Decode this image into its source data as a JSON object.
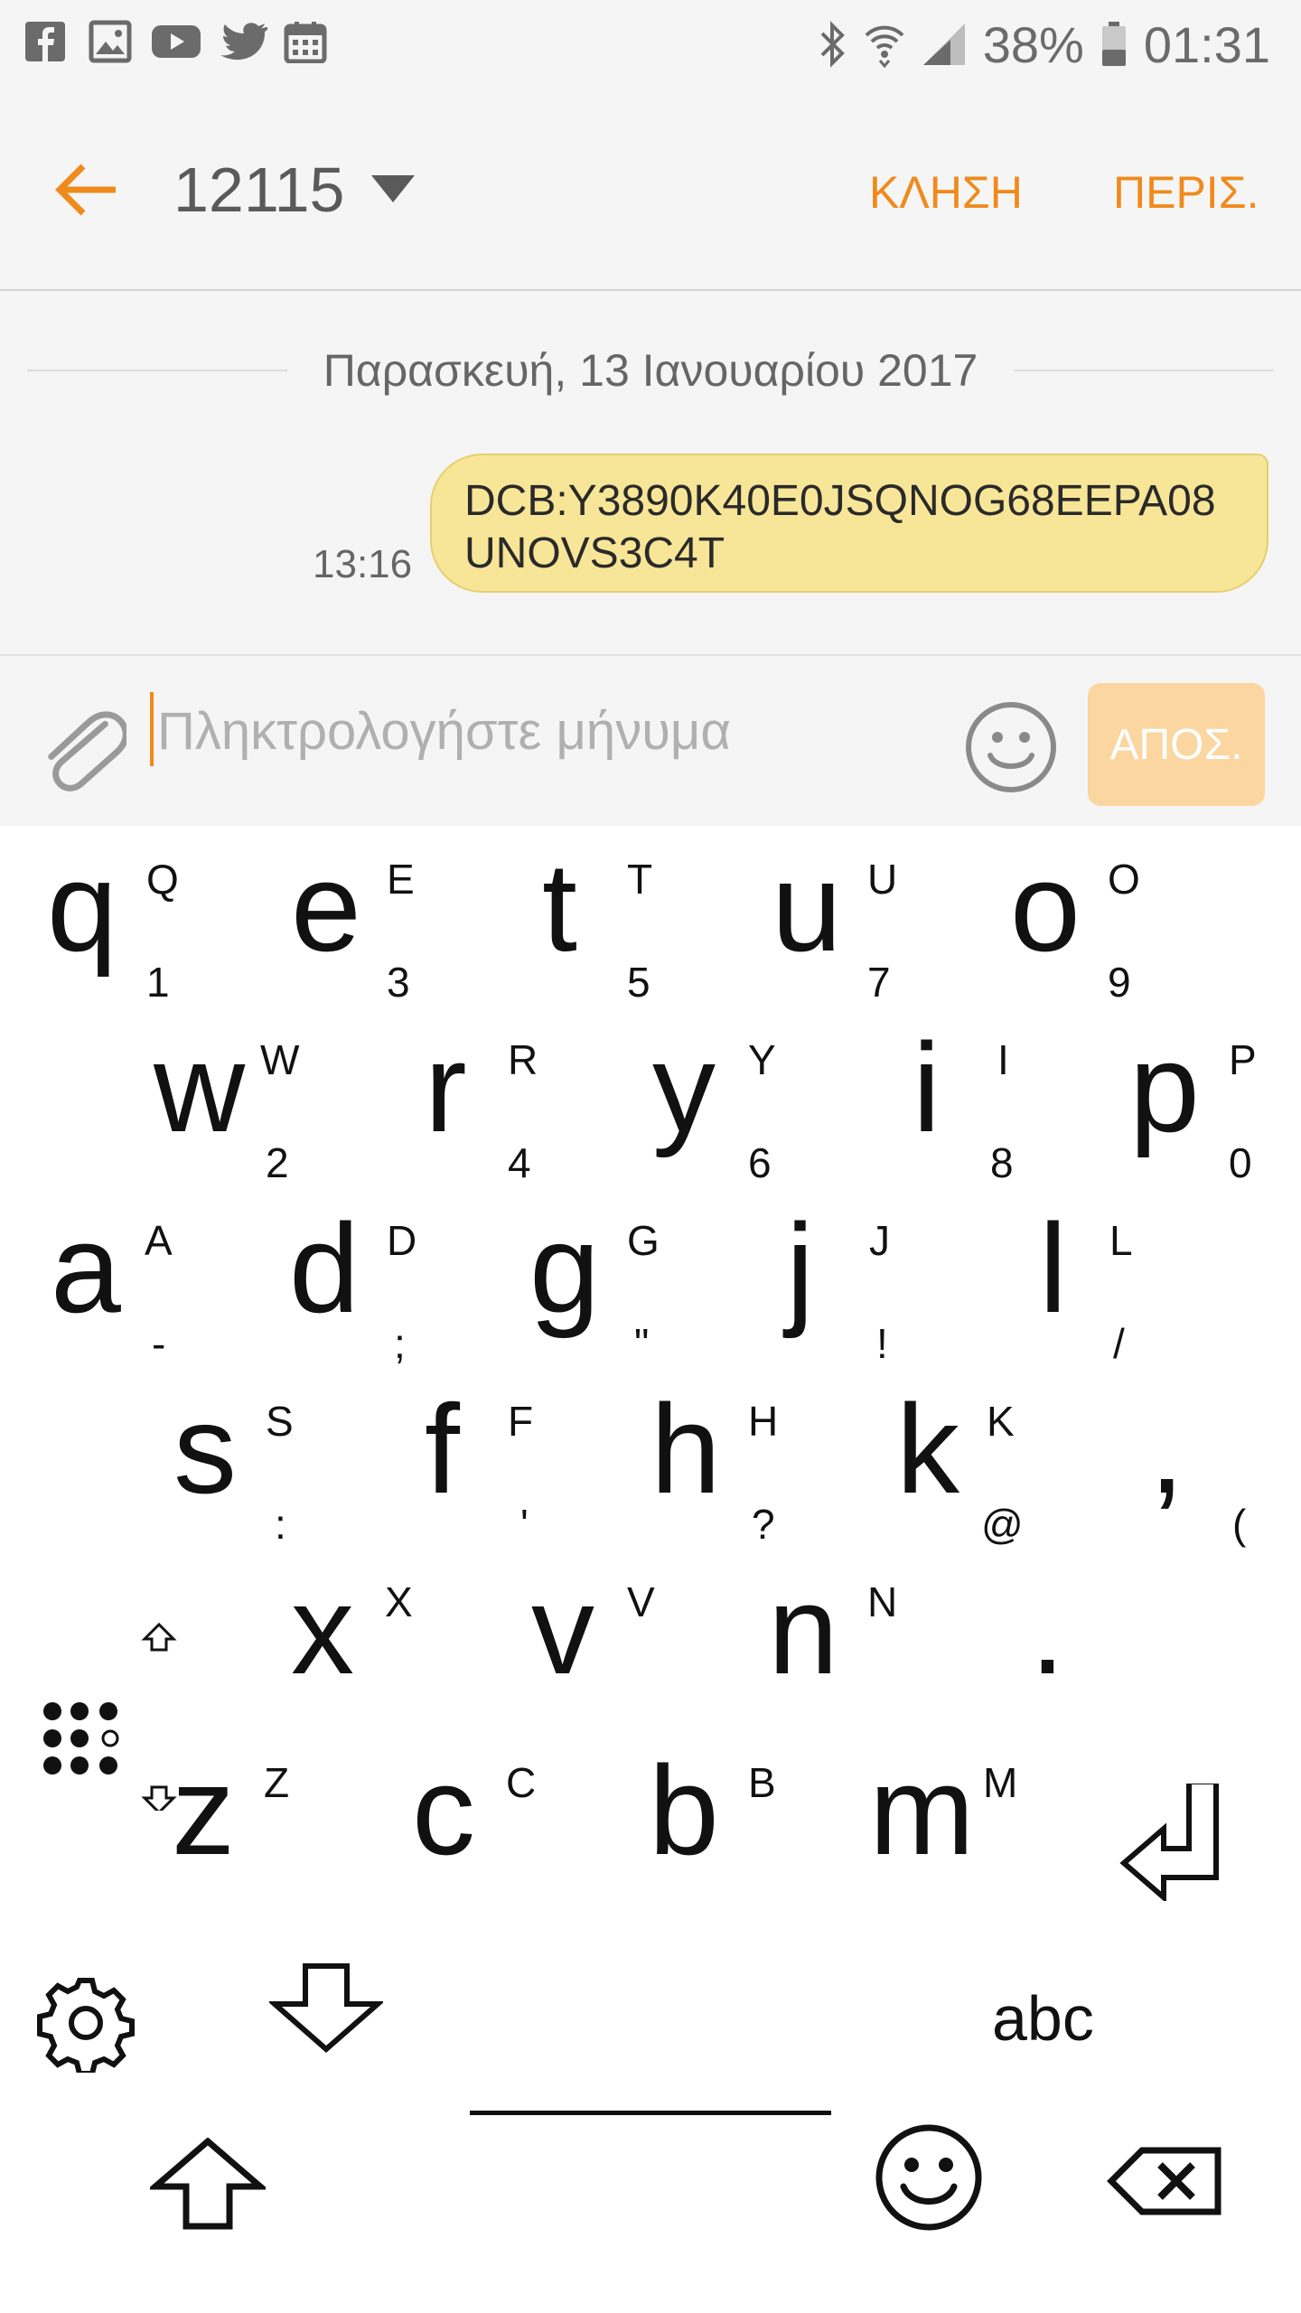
{
  "status_bar": {
    "icons_left": [
      "facebook-icon",
      "gallery-icon",
      "youtube-icon",
      "twitter-icon",
      "calendar-icon"
    ],
    "icons_right": [
      "bluetooth-icon",
      "wifi-icon",
      "signal-icon",
      "battery-icon"
    ],
    "battery": "38%",
    "time": "01:31"
  },
  "header": {
    "contact": "12115",
    "call_label": "ΚΛΗΣΗ",
    "more_label": "ΠΕΡΙΣ.",
    "accent": "#ef8a1c"
  },
  "conversation": {
    "date": "Παρασκευή, 13 Ιανουαρίου 2017",
    "messages": [
      {
        "time": "13:16",
        "line1": "DCB:Y3890K40E0JSQNOG68EEPA08",
        "line2": "UNOVS3C4T",
        "bubble_color": "#f8e698"
      }
    ]
  },
  "composer": {
    "placeholder": "Πληκτρολογήστε μήνυμα",
    "send_label": "ΑΠΟΣ."
  },
  "keyboard": {
    "rows": [
      [
        {
          "k": "q",
          "sup": "Q",
          "sub": "1"
        },
        {
          "k": "e",
          "sup": "E",
          "sub": "3"
        },
        {
          "k": "t",
          "sup": "T",
          "sub": "5"
        },
        {
          "k": "u",
          "sup": "U",
          "sub": "7"
        },
        {
          "k": "o",
          "sup": "O",
          "sub": "9"
        }
      ],
      [
        {
          "k": "w",
          "sup": "W",
          "sub": "2"
        },
        {
          "k": "r",
          "sup": "R",
          "sub": "4"
        },
        {
          "k": "y",
          "sup": "Y",
          "sub": "6"
        },
        {
          "k": "i",
          "sup": "I",
          "sub": "8"
        },
        {
          "k": "p",
          "sup": "P",
          "sub": "0"
        }
      ],
      [
        {
          "k": "a",
          "sup": "A",
          "sub": "-"
        },
        {
          "k": "d",
          "sup": "D",
          "sub": ";"
        },
        {
          "k": "g",
          "sup": "G",
          "sub": "\""
        },
        {
          "k": "j",
          "sup": "J",
          "sub": "!"
        },
        {
          "k": "l",
          "sup": "L",
          "sub": "/"
        }
      ],
      [
        {
          "k": "s",
          "sup": "S",
          "sub": ":"
        },
        {
          "k": "f",
          "sup": "F",
          "sub": "'"
        },
        {
          "k": "h",
          "sup": "H",
          "sub": "?"
        },
        {
          "k": "k",
          "sup": "K",
          "sub": "@"
        },
        {
          "k": ",",
          "sup": "",
          "sub": "("
        }
      ],
      [
        {
          "k": "x",
          "sup": "X",
          "sub": ""
        },
        {
          "k": "v",
          "sup": "V",
          "sub": ""
        },
        {
          "k": "n",
          "sup": "N",
          "sub": ""
        },
        {
          "k": ".",
          "sup": "",
          "sub": ""
        }
      ],
      [
        {
          "k": "z",
          "sup": "Z",
          "sub": ""
        },
        {
          "k": "c",
          "sup": "C",
          "sub": ""
        },
        {
          "k": "b",
          "sup": "B",
          "sub": ""
        },
        {
          "k": "m",
          "sup": "M",
          "sub": ""
        }
      ]
    ],
    "mode_label": "abc",
    "icons": [
      "settings-icon",
      "hide-keyboard-icon",
      "shift-icon",
      "emoji-icon",
      "backspace-icon",
      "enter-icon",
      "braille-dots-icon"
    ]
  }
}
